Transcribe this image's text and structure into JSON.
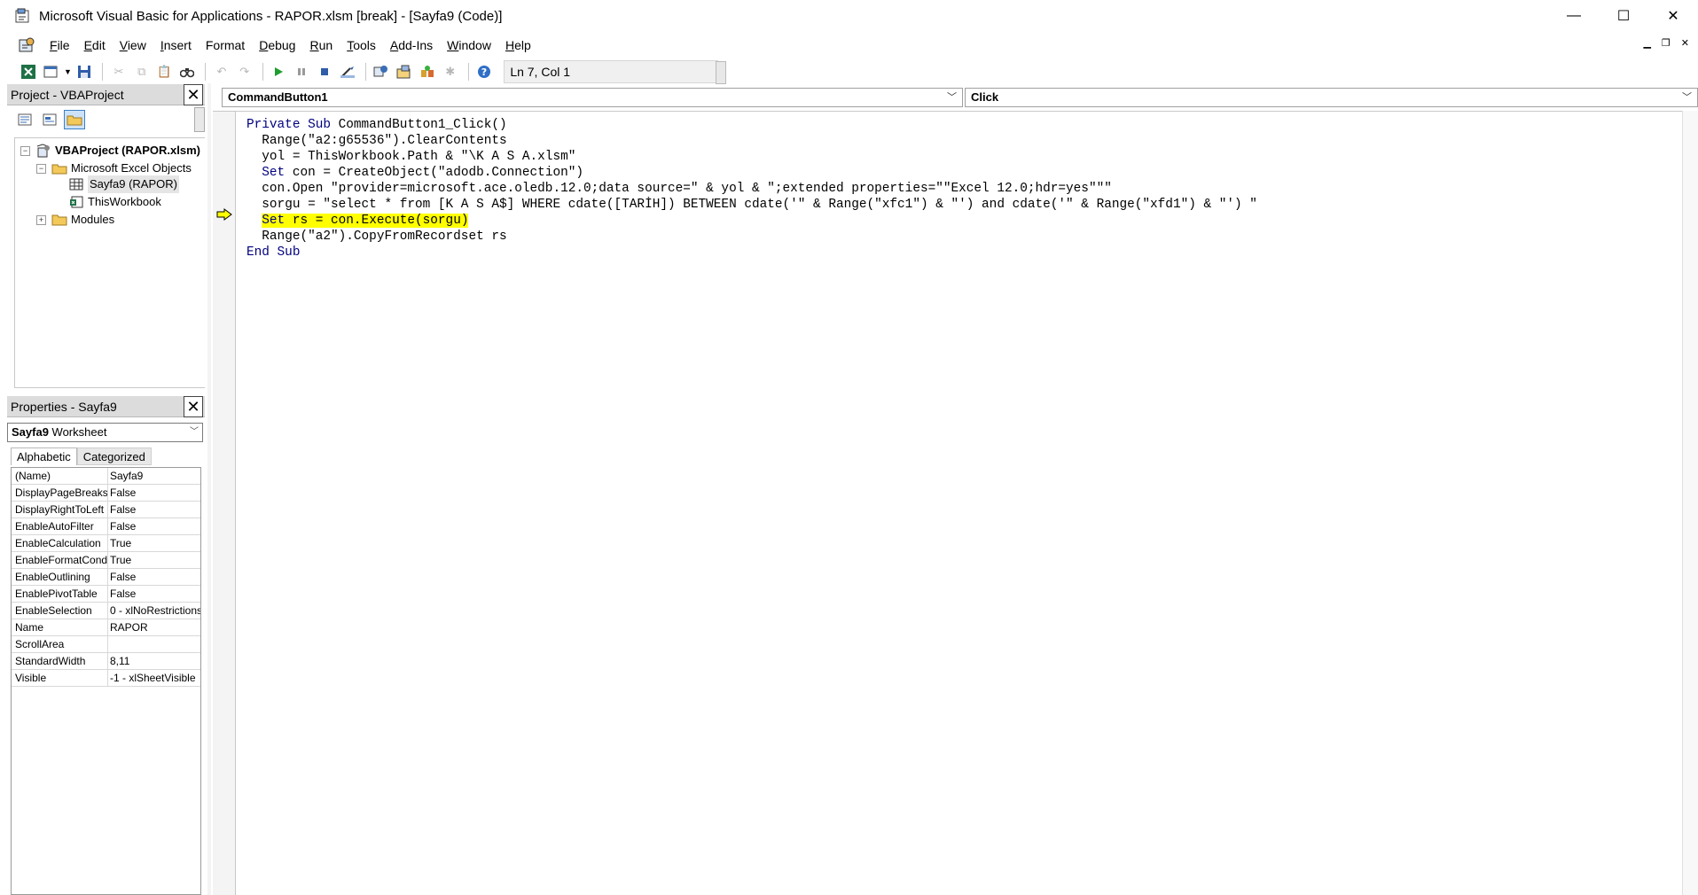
{
  "window": {
    "title": "Microsoft Visual Basic for Applications - RAPOR.xlsm [break] - [Sayfa9 (Code)]",
    "minimize": "—",
    "maximize": "☐",
    "close": "✕"
  },
  "menu": {
    "items": [
      {
        "acc": "F",
        "rest": "ile"
      },
      {
        "acc": "E",
        "rest": "dit"
      },
      {
        "acc": "V",
        "rest": "iew"
      },
      {
        "acc": "I",
        "rest": "nsert"
      },
      {
        "acc": "F",
        "rest": "ormat",
        "pre": ""
      },
      {
        "acc": "D",
        "rest": "ebug"
      },
      {
        "acc": "R",
        "rest": "un"
      },
      {
        "acc": "T",
        "rest": "ools"
      },
      {
        "acc": "A",
        "rest": "dd-Ins"
      },
      {
        "acc": "W",
        "rest": "indow"
      },
      {
        "acc": "H",
        "rest": "elp"
      }
    ]
  },
  "toolbar": {
    "status": "Ln 7, Col 1"
  },
  "project": {
    "title": "Project - VBAProject",
    "root": "VBAProject (RAPOR.xlsm)",
    "excel_objects": "Microsoft Excel Objects",
    "sheet": "Sayfa9 (RAPOR)",
    "workbook": "ThisWorkbook",
    "modules": "Modules"
  },
  "properties": {
    "title": "Properties - Sayfa9",
    "object_name": "Sayfa9",
    "object_type": "Worksheet",
    "tab_alphabetic": "Alphabetic",
    "tab_categorized": "Categorized",
    "rows": [
      {
        "name": "(Name)",
        "value": "Sayfa9"
      },
      {
        "name": "DisplayPageBreaks",
        "value": "False"
      },
      {
        "name": "DisplayRightToLeft",
        "value": "False"
      },
      {
        "name": "EnableAutoFilter",
        "value": "False"
      },
      {
        "name": "EnableCalculation",
        "value": "True"
      },
      {
        "name": "EnableFormatConditionsCalculation",
        "value": "True"
      },
      {
        "name": "EnableOutlining",
        "value": "False"
      },
      {
        "name": "EnablePivotTable",
        "value": "False"
      },
      {
        "name": "EnableSelection",
        "value": "0 - xlNoRestrictions"
      },
      {
        "name": "Name",
        "value": "RAPOR"
      },
      {
        "name": "ScrollArea",
        "value": ""
      },
      {
        "name": "StandardWidth",
        "value": "8,11"
      },
      {
        "name": "Visible",
        "value": "-1 - xlSheetVisible"
      }
    ]
  },
  "code": {
    "object_combo": "CommandButton1",
    "proc_combo": "Click",
    "lines": [
      {
        "indent": "",
        "kw": "Private Sub",
        "text": " CommandButton1_Click()"
      },
      {
        "indent": "  ",
        "kw": "",
        "text": "Range(\"a2:g65536\").ClearContents"
      },
      {
        "indent": "  ",
        "kw": "",
        "text": "yol = ThisWorkbook.Path & \"\\K A S A.xlsm\""
      },
      {
        "indent": "  ",
        "kw": "Set",
        "text": " con = CreateObject(\"adodb.Connection\")"
      },
      {
        "indent": "  ",
        "kw": "",
        "text": "con.Open \"provider=microsoft.ace.oledb.12.0;data source=\" & yol & \";extended properties=\"\"Excel 12.0;hdr=yes\"\"\""
      },
      {
        "indent": "  ",
        "kw": "",
        "text": "sorgu = \"select * from [K A S A$] WHERE cdate([TARİH]) BETWEEN cdate('\" & Range(\"xfc1\") & \"') and cdate('\" & Range(\"xfd1\") & \"') \""
      },
      {
        "indent": "  ",
        "kw": "Set",
        "text": " rs = con.Execute(sorgu)",
        "highlight": true
      },
      {
        "indent": "  ",
        "kw": "",
        "text": "Range(\"a2\").CopyFromRecordset rs"
      },
      {
        "indent": "",
        "kw": "End Sub",
        "text": ""
      }
    ]
  }
}
